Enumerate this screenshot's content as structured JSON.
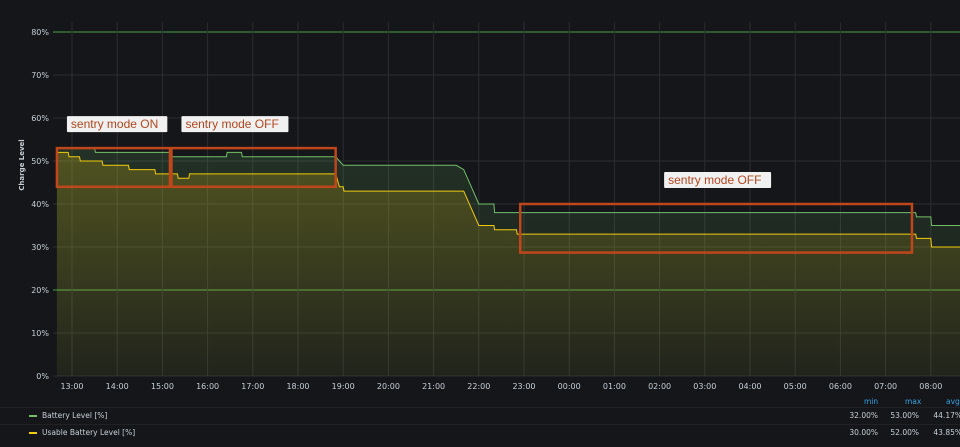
{
  "colors": {
    "background": "#141619",
    "grid": "#2b2d31",
    "threshold": "#46a348",
    "battery": "#73bf69",
    "usable": "#f2cc0c",
    "annotation": "#c0461c"
  },
  "chart_data": {
    "type": "area",
    "ylabel": "Charge Level",
    "ylim": [
      0,
      80
    ],
    "yticks": [
      "0%",
      "10%",
      "20%",
      "30%",
      "40%",
      "50%",
      "60%",
      "70%",
      "80%"
    ],
    "xticks": [
      "13:00",
      "14:00",
      "15:00",
      "16:00",
      "17:00",
      "18:00",
      "19:00",
      "20:00",
      "21:00",
      "22:00",
      "23:00",
      "00:00",
      "01:00",
      "02:00",
      "03:00",
      "04:00",
      "05:00",
      "06:00",
      "07:00",
      "08:00"
    ],
    "thresholds": [
      20,
      80
    ],
    "grid": true,
    "series": [
      {
        "name": "Battery Level [%]",
        "color": "#73bf69",
        "points": [
          [
            "12:40",
            53
          ],
          [
            "13:30",
            53
          ],
          [
            "13:31",
            52
          ],
          [
            "15:10",
            52
          ],
          [
            "15:11",
            51
          ],
          [
            "16:25",
            51
          ],
          [
            "16:26",
            52
          ],
          [
            "16:45",
            52
          ],
          [
            "16:46",
            51
          ],
          [
            "18:50",
            51
          ],
          [
            "18:55",
            50
          ],
          [
            "19:00",
            49
          ],
          [
            "20:00",
            49
          ],
          [
            "21:30",
            49
          ],
          [
            "21:40",
            48
          ],
          [
            "21:50",
            44
          ],
          [
            "22:00",
            40
          ],
          [
            "22:20",
            40
          ],
          [
            "22:21",
            38
          ],
          [
            "23:00",
            38
          ],
          [
            "07:40",
            38
          ],
          [
            "07:41",
            37
          ],
          [
            "08:00",
            37
          ],
          [
            "08:01",
            35
          ],
          [
            "08:40",
            35
          ],
          [
            "08:45",
            32
          ]
        ]
      },
      {
        "name": "Usable Battery Level [%]",
        "color": "#f2cc0c",
        "points": [
          [
            "12:40",
            52
          ],
          [
            "12:55",
            52
          ],
          [
            "12:56",
            51
          ],
          [
            "13:10",
            51
          ],
          [
            "13:11",
            50
          ],
          [
            "13:40",
            50
          ],
          [
            "13:41",
            49
          ],
          [
            "14:15",
            49
          ],
          [
            "14:16",
            48
          ],
          [
            "14:50",
            48
          ],
          [
            "14:51",
            47
          ],
          [
            "15:20",
            47
          ],
          [
            "15:21",
            46
          ],
          [
            "15:35",
            46
          ],
          [
            "15:36",
            47
          ],
          [
            "18:50",
            47
          ],
          [
            "18:55",
            44
          ],
          [
            "19:00",
            44
          ],
          [
            "19:01",
            43
          ],
          [
            "21:40",
            43
          ],
          [
            "21:50",
            39
          ],
          [
            "22:00",
            35
          ],
          [
            "22:20",
            35
          ],
          [
            "22:21",
            34
          ],
          [
            "22:50",
            34
          ],
          [
            "22:51",
            33
          ],
          [
            "07:40",
            33
          ],
          [
            "07:41",
            32
          ],
          [
            "08:00",
            32
          ],
          [
            "08:01",
            30
          ],
          [
            "08:40",
            30
          ],
          [
            "08:45",
            30
          ]
        ]
      }
    ],
    "annotations": [
      {
        "label": "sentry mode ON",
        "from": "12:40",
        "to": "15:10",
        "y_top": 53,
        "y_bottom": 44
      },
      {
        "label": "sentry mode OFF",
        "from": "15:12",
        "to": "18:50",
        "y_top": 53,
        "y_bottom": 44
      },
      {
        "label": "sentry mode OFF",
        "from": "22:55",
        "to": "07:35",
        "y_top": 40,
        "y_bottom": 28.7
      }
    ]
  },
  "legend": {
    "headers": [
      "min",
      "max",
      "avg"
    ],
    "rows": [
      {
        "name": "Battery Level [%]",
        "min": "32.00%",
        "max": "53.00%",
        "avg": "44.17%"
      },
      {
        "name": "Usable Battery Level [%]",
        "min": "30.00%",
        "max": "52.00%",
        "avg": "43.85%"
      }
    ]
  }
}
